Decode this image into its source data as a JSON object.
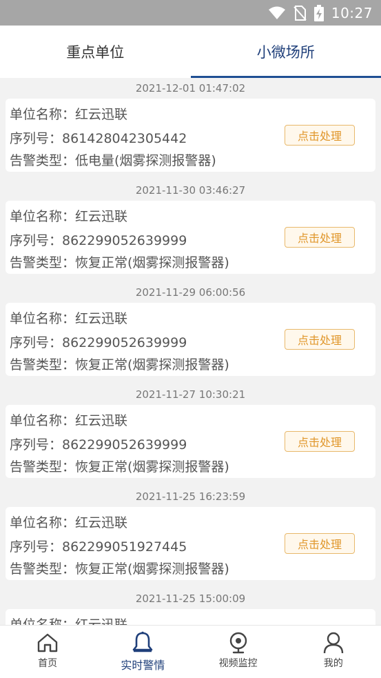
{
  "status_bar": {
    "time": "10:27"
  },
  "tabs": [
    {
      "label": "重点单位",
      "active": false
    },
    {
      "label": "小微场所",
      "active": true
    }
  ],
  "alarms": [
    {
      "time": "2021-12-01 01:47:02",
      "unit": "单位名称：红云迅联",
      "serial": "序列号：861428042305442",
      "type": "告警类型：低电量(烟雾探测报警器)",
      "action": "点击处理"
    },
    {
      "time": "2021-11-30 03:46:27",
      "unit": "单位名称：红云迅联",
      "serial": "序列号：862299052639999",
      "type": "告警类型：恢复正常(烟雾探测报警器)",
      "action": "点击处理"
    },
    {
      "time": "2021-11-29 06:00:56",
      "unit": "单位名称：红云迅联",
      "serial": "序列号：862299052639999",
      "type": "告警类型：恢复正常(烟雾探测报警器)",
      "action": "点击处理"
    },
    {
      "time": "2021-11-27 10:30:21",
      "unit": "单位名称：红云迅联",
      "serial": "序列号：862299052639999",
      "type": "告警类型：恢复正常(烟雾探测报警器)",
      "action": "点击处理"
    },
    {
      "time": "2021-11-25 16:23:59",
      "unit": "单位名称：红云迅联",
      "serial": "序列号：862299051927445",
      "type": "告警类型：恢复正常(烟雾探测报警器)",
      "action": "点击处理"
    },
    {
      "time": "2021-11-25 15:00:09",
      "unit": "单位名称：红云迅联",
      "serial": "",
      "type": "",
      "action": ""
    }
  ],
  "bottom_nav": [
    {
      "label": "首页",
      "icon": "home-icon",
      "active": false
    },
    {
      "label": "实时警情",
      "icon": "bell-icon",
      "active": true
    },
    {
      "label": "视频监控",
      "icon": "camera-icon",
      "active": false
    },
    {
      "label": "我的",
      "icon": "user-icon",
      "active": false
    }
  ],
  "colors": {
    "accent": "#1f3f7a",
    "button_border": "#e8b86a",
    "button_text": "#e0962a",
    "status_bar": "#a6a6a6"
  }
}
